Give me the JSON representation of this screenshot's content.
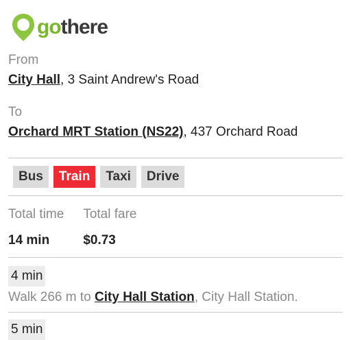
{
  "brand": {
    "prefix": "go",
    "suffix": "there",
    "accent": "#78b82a"
  },
  "from": {
    "label": "From",
    "place": "City Hall",
    "rest": ", 3 Saint Andrew's Road"
  },
  "to": {
    "label": "To",
    "place": "Orchard MRT Station (NS22)",
    "rest": ", 437 Orchard Road"
  },
  "modes": [
    {
      "label": "Bus"
    },
    {
      "label": "Train",
      "active": true
    },
    {
      "label": "Taxi"
    },
    {
      "label": "Drive"
    }
  ],
  "active_color": "#ee2b35",
  "summary": {
    "time_label": "Total time",
    "time_value": "14 min",
    "fare_label": "Total fare",
    "fare_value": "$0.73"
  },
  "steps": [
    {
      "duration": "4 min",
      "text_before": "Walk 266 m to ",
      "place": "City Hall Station",
      "text_after": ", City Hall Station."
    },
    {
      "duration": "5 min"
    }
  ]
}
